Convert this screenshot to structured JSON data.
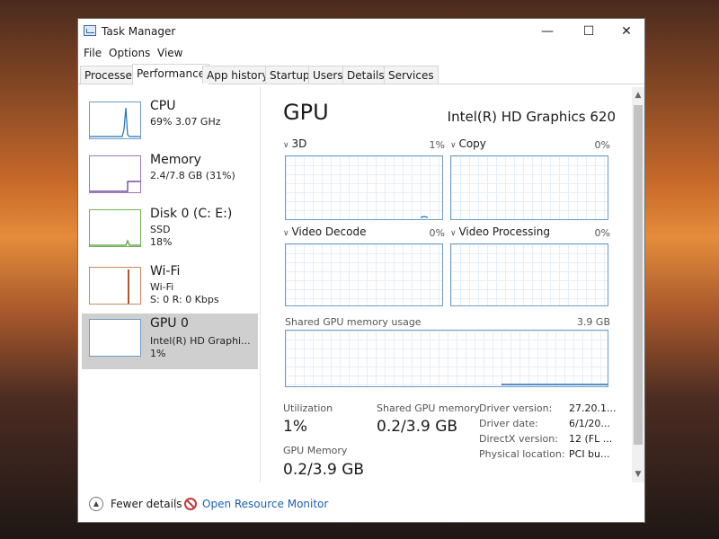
{
  "window": {
    "title": "Task Manager",
    "controls": [
      "minimize-icon",
      "maximize-icon",
      "close-icon"
    ]
  },
  "menu": {
    "file": "File",
    "options": "Options",
    "view": "View"
  },
  "tabs": [
    "Processes",
    "Performance",
    "App history",
    "Startup",
    "Users",
    "Details",
    "Services"
  ],
  "active_tab": "Performance",
  "sidebar": {
    "items": [
      {
        "name": "CPU",
        "line1": "69% 3.07 GHz",
        "color": "#1f6fb8"
      },
      {
        "name": "Memory",
        "line1": "2.4/7.8 GB (31%)",
        "color": "#5b2b91"
      },
      {
        "name": "Disk 0 (C: E:)",
        "line1": "SSD",
        "line2": "18%",
        "color": "#4f9a35"
      },
      {
        "name": "Wi-Fi",
        "line1": "Wi-Fi",
        "line2": "S: 0 R: 0 Kbps",
        "color": "#b0562b"
      },
      {
        "name": "GPU 0",
        "line1": "Intel(R) HD Graphi...",
        "line2": "1%",
        "color": "#1f6fb8"
      }
    ],
    "selected": "GPU 0"
  },
  "gpu": {
    "title": "GPU",
    "model": "Intel(R) HD Graphics 620",
    "engines": [
      {
        "label": "3D",
        "pct": "1%"
      },
      {
        "label": "Copy",
        "pct": "0%"
      },
      {
        "label": "Video Decode",
        "pct": "0%"
      },
      {
        "label": "Video Processing",
        "pct": "0%"
      }
    ],
    "shared_memory_graph": {
      "label": "Shared GPU memory usage",
      "value": "3.9 GB"
    },
    "stats": {
      "utilization_label": "Utilization",
      "utilization_value": "1%",
      "shared_mem_label": "Shared GPU memory",
      "shared_mem_value": "0.2/3.9 GB",
      "gpu_mem_label": "GPU Memory",
      "gpu_mem_value": "0.2/3.9 GB"
    },
    "driver": {
      "version_label": "Driver version:",
      "version_value": "27.20.1...",
      "date_label": "Driver date:",
      "date_value": "6/1/20...",
      "directx_label": "DirectX version:",
      "directx_value": "12 (FL ...",
      "location_label": "Physical location:",
      "location_value": "PCI bu..."
    }
  },
  "footer": {
    "fewer_details": "Fewer details",
    "resource_monitor": "Open Resource Monitor"
  },
  "colors": {
    "graph_border": "#6d9bc4",
    "grid": "#e6eef6",
    "link": "#1a5fb4",
    "selected": "#cfcfcf"
  }
}
